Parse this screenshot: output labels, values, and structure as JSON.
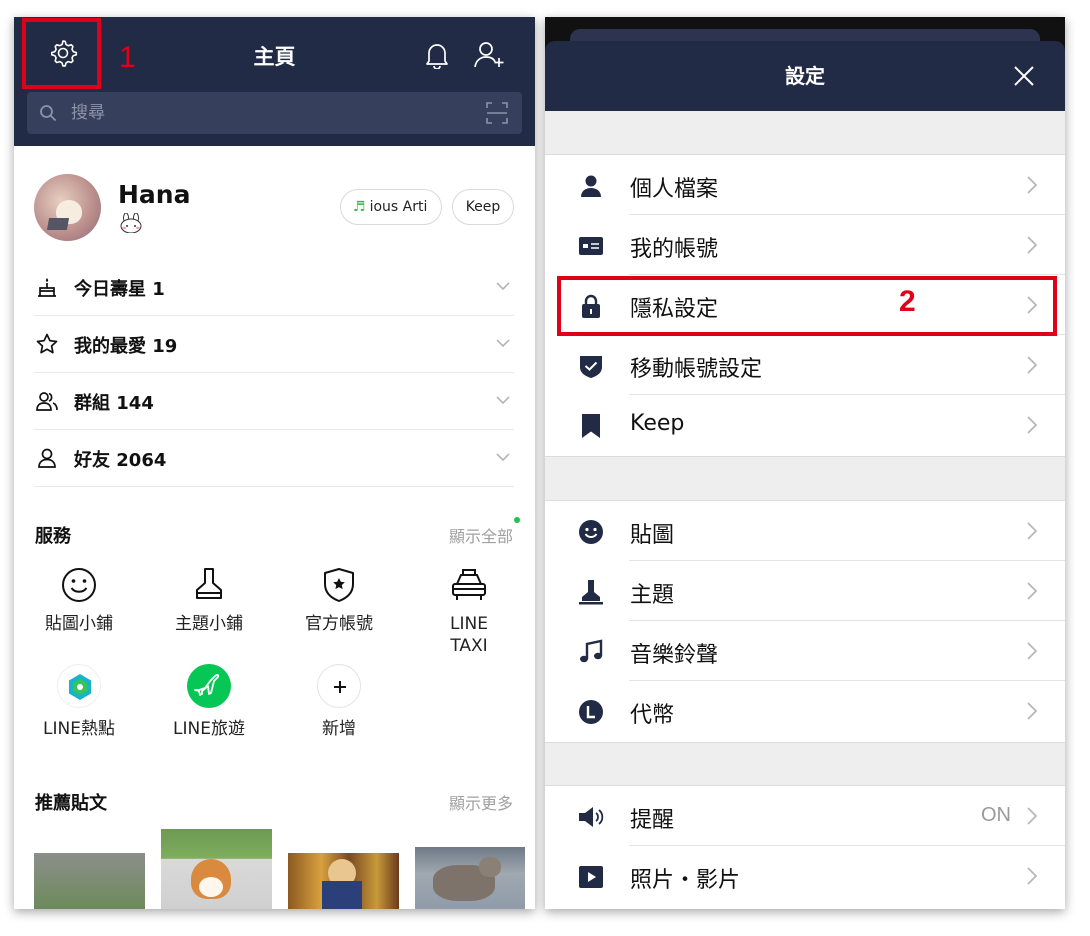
{
  "annotations": {
    "marker1": "1",
    "marker2": "2"
  },
  "home": {
    "title": "主頁",
    "search": {
      "placeholder": "搜尋"
    },
    "profile": {
      "name": "Hana",
      "music_pill": "ious Arti",
      "keep_pill": "Keep"
    },
    "lists": [
      {
        "label": "今日壽星 1",
        "icon": "cake-icon"
      },
      {
        "label": "我的最愛 19",
        "icon": "star-icon"
      },
      {
        "label": "群組 144",
        "icon": "group-icon"
      },
      {
        "label": "好友 2064",
        "icon": "person-icon"
      }
    ],
    "services": {
      "title": "服務",
      "more": "顯示全部",
      "items": [
        {
          "label": "貼圖小鋪",
          "icon": "smiley-icon"
        },
        {
          "label": "主題小鋪",
          "icon": "theme-brush-icon"
        },
        {
          "label": "官方帳號",
          "icon": "official-shield-icon"
        },
        {
          "label": "LINE\nTAXI",
          "icon": "taxi-icon"
        },
        {
          "label": "LINE熱點",
          "icon": "line-spot-icon"
        },
        {
          "label": "LINE旅遊",
          "icon": "line-travel-icon"
        },
        {
          "label": "新增",
          "icon": "plus-icon"
        }
      ]
    },
    "posts": {
      "title": "推薦貼文",
      "more": "顯示更多"
    }
  },
  "settings": {
    "title": "設定",
    "group1": [
      {
        "label": "個人檔案",
        "icon": "profile-icon"
      },
      {
        "label": "我的帳號",
        "icon": "account-card-icon"
      },
      {
        "label": "隱私設定",
        "icon": "lock-icon"
      },
      {
        "label": "移動帳號設定",
        "icon": "shield-check-icon"
      },
      {
        "label": "Keep",
        "icon": "bookmark-icon"
      }
    ],
    "group2": [
      {
        "label": "貼圖",
        "icon": "sticker-icon"
      },
      {
        "label": "主題",
        "icon": "theme-icon"
      },
      {
        "label": "音樂鈴聲",
        "icon": "music-note-icon"
      },
      {
        "label": "代幣",
        "icon": "coin-icon"
      }
    ],
    "group3": [
      {
        "label": "提醒",
        "icon": "speaker-icon",
        "value": "ON"
      },
      {
        "label": "照片・影片",
        "icon": "play-icon"
      }
    ]
  },
  "colors": {
    "header": "#222b45",
    "highlight": "#e0001a",
    "line_green": "#06c755"
  }
}
